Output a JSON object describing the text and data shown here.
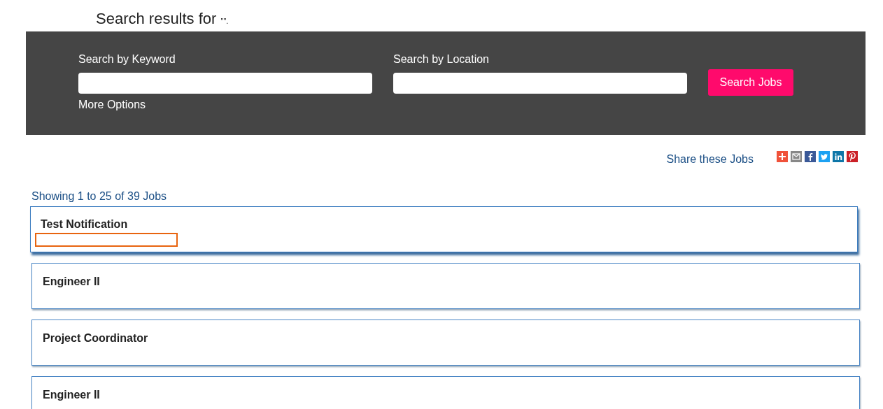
{
  "heading": {
    "text": "Search results for ",
    "query": "\"\"."
  },
  "search": {
    "keyword_label": "Search by Keyword",
    "location_label": "Search by Location",
    "button": "Search Jobs",
    "more_options": "More Options"
  },
  "share": {
    "label": "Share these Jobs",
    "icons": [
      {
        "kind": "plus",
        "color": "#f0523a"
      },
      {
        "kind": "mail",
        "color": "#888888"
      },
      {
        "kind": "facebook",
        "color": "#3b5998"
      },
      {
        "kind": "twitter",
        "color": "#1da1f2"
      },
      {
        "kind": "linkedin",
        "color": "#0e76a8"
      },
      {
        "kind": "pinterest",
        "color": "#cb2027"
      }
    ]
  },
  "results_count": "Showing 1 to 25 of 39 Jobs",
  "jobs": [
    {
      "title": "Test Notification",
      "selected": true
    },
    {
      "title": "Engineer II",
      "selected": false
    },
    {
      "title": "Project Coordinator",
      "selected": false
    },
    {
      "title": "Engineer II",
      "selected": false
    }
  ]
}
